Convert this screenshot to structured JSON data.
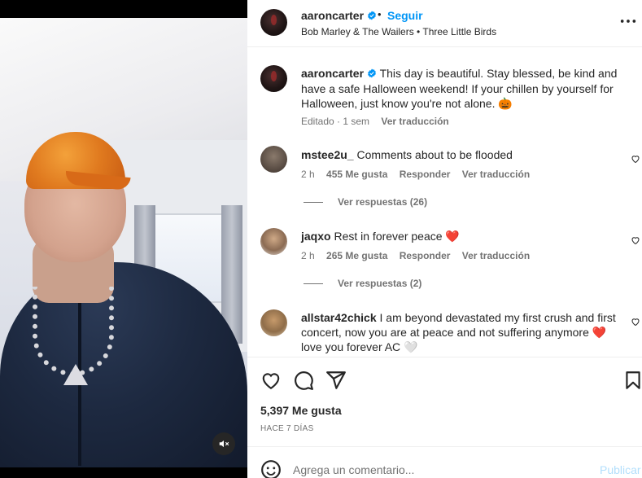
{
  "header": {
    "username": "aaroncarter",
    "separator": "•",
    "follow_label": "Seguir",
    "song": "Bob Marley & The Wailers • Three Little Birds"
  },
  "caption": {
    "username": "aaroncarter",
    "text": "This day is beautiful. Stay blessed, be kind and have a safe Halloween weekend! If your chillen by yourself for Halloween, just know you're not alone. 🎃",
    "edited": "Editado · 1 sem",
    "translate": "Ver traducción"
  },
  "comments": [
    {
      "username": "mstee2u_",
      "text": "Comments about to be flooded",
      "time": "2 h",
      "likes": "455 Me gusta",
      "reply": "Responder",
      "translate": "Ver traducción",
      "view_replies": "Ver respuestas (26)"
    },
    {
      "username": "jaqxo",
      "text": "Rest in forever peace ❤️",
      "time": "2 h",
      "likes": "265 Me gusta",
      "reply": "Responder",
      "translate": "Ver traducción",
      "view_replies": "Ver respuestas (2)"
    },
    {
      "username": "allstar42chick",
      "text": "I am beyond devastated my first crush and first concert, now you are at peace and not suffering anymore ❤️ love you forever AC 🤍"
    }
  ],
  "post": {
    "likes": "5,397 Me gusta",
    "time_ago": "HACE 7 DÍAS"
  },
  "add_comment": {
    "placeholder": "Agrega un comentario...",
    "publish_label": "Publicar"
  },
  "icons": {
    "verified": "verified-badge-icon",
    "more": "more-options-icon",
    "like": "heart-icon",
    "comment": "comment-icon",
    "share": "share-icon",
    "save": "bookmark-icon",
    "emoji": "emoji-icon",
    "mute": "mute-icon"
  },
  "colors": {
    "accent": "#0095f6",
    "secondary_text": "#737373",
    "publish_disabled": "#b2dffc"
  }
}
